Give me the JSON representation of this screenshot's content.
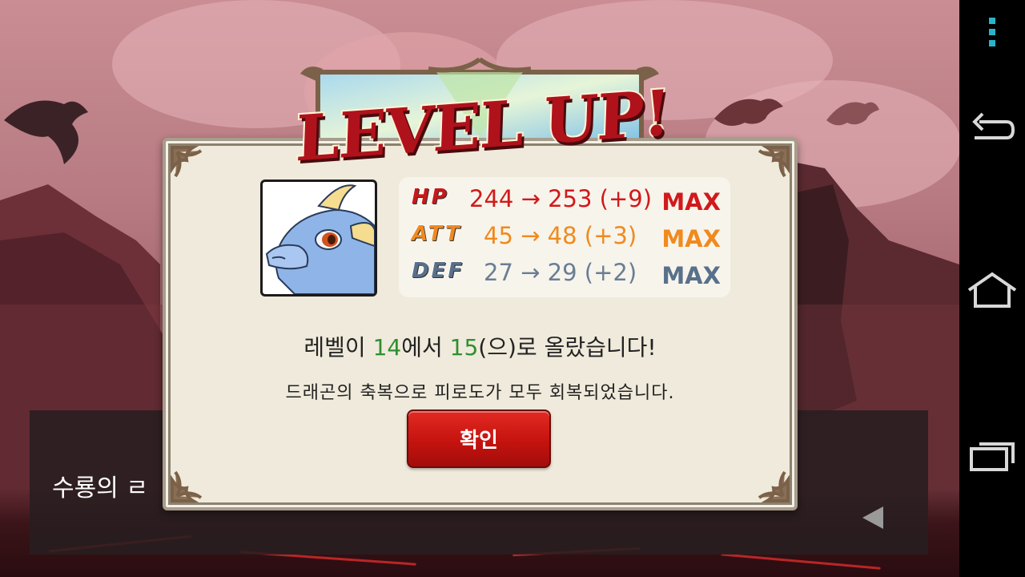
{
  "popup": {
    "title": "LEVEL UP!",
    "stats": [
      {
        "label": "HP",
        "value_text": "244 → 253 (+9)",
        "max_text": "MAX",
        "color": "#d11a1a",
        "label_color": "#c81818"
      },
      {
        "label": "ATT",
        "value_text": "45 → 48 (+3)",
        "max_text": "MAX",
        "color": "#f08a1e",
        "label_color": "#f08a1e"
      },
      {
        "label": "DEF",
        "value_text": "27 → 29 (+2)",
        "max_text": "MAX",
        "color": "#6a7e93",
        "label_color": "#58708a"
      }
    ],
    "message_line1": {
      "prefix": "레벨이 ",
      "from_level": "14",
      "middle": "에서 ",
      "to_level": "15",
      "suffix": "(으)로 올랐습니다!"
    },
    "message_line2": "드래곤의 축복으로 피로도가 모두 회복되었습니다.",
    "confirm_label": "확인"
  },
  "dialogue": {
    "text": "수룡의 ㄹ"
  },
  "navbar": {
    "icons": [
      "menu-dots-icon",
      "back-icon",
      "home-icon",
      "recents-icon"
    ],
    "accent_color": "#2bb3c9"
  }
}
